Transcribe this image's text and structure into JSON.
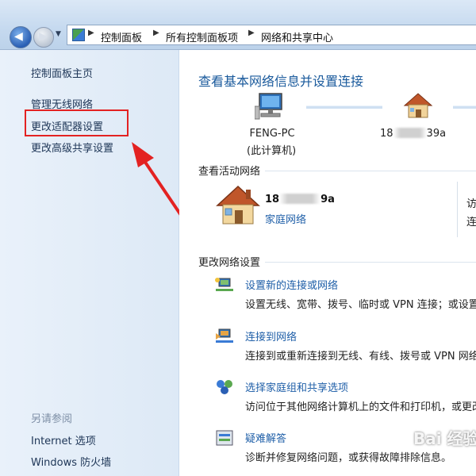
{
  "breadcrumb": {
    "items": [
      "控制面板",
      "所有控制面板项",
      "网络和共享中心"
    ]
  },
  "sidebar": {
    "home": "控制面板主页",
    "items": [
      {
        "label": "管理无线网络"
      },
      {
        "label": "更改适配器设置"
      },
      {
        "label": "更改高级共享设置"
      }
    ],
    "see_also_title": "另请参阅",
    "see_also": [
      {
        "label": "Internet 选项"
      },
      {
        "label": "Windows 防火墙"
      }
    ]
  },
  "main": {
    "title": "查看基本网络信息并设置连接",
    "computer": {
      "name": "FENG-PC",
      "sub": "(此计算机)"
    },
    "network_top": {
      "prefix": "18",
      "suffix": "39a"
    },
    "active_section": "查看活动网络",
    "active_network": {
      "prefix": "18",
      "suffix": "9a",
      "type": "家庭网络",
      "cut_1": "访",
      "cut_2": "连"
    },
    "change_section": "更改网络设置",
    "tasks": [
      {
        "icon": "new-connection-icon",
        "link": "设置新的连接或网络",
        "desc": "设置无线、宽带、拨号、临时或 VPN 连接；或设置"
      },
      {
        "icon": "connect-to-network-icon",
        "link": "连接到网络",
        "desc": "连接到或重新连接到无线、有线、拨号或 VPN 网络连"
      },
      {
        "icon": "homegroup-icon",
        "link": "选择家庭组和共享选项",
        "desc": "访问位于其他网络计算机上的文件和打印机，或更改"
      },
      {
        "icon": "troubleshoot-icon",
        "link": "疑难解答",
        "desc": "诊断并修复网络问题，或获得故障排除信息。"
      }
    ]
  },
  "watermark": "Bai 经验",
  "colors": {
    "link": "#1f5fa8",
    "title": "#1a5a9c",
    "highlight": "#e32222"
  }
}
